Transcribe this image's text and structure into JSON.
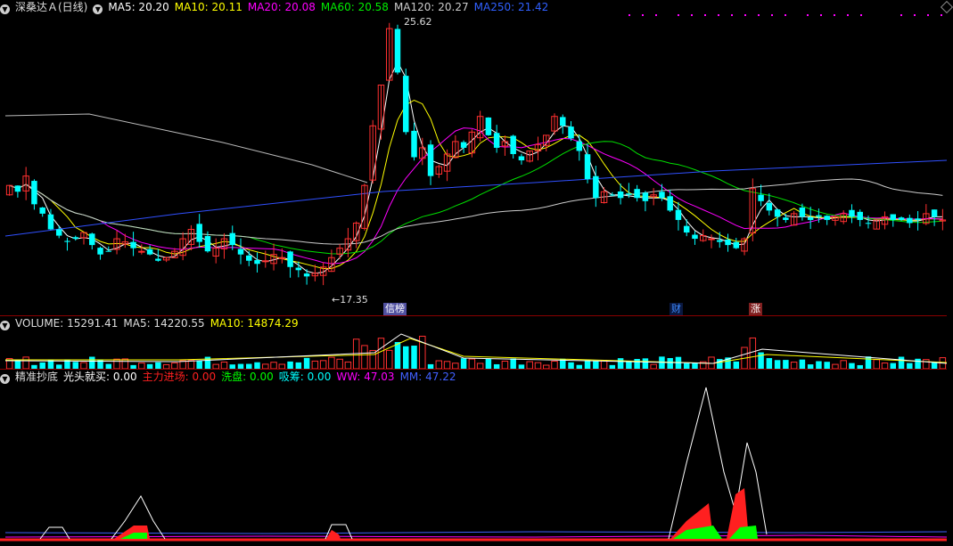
{
  "main_header": {
    "title": "深桑达Ａ(日线)",
    "ma": [
      {
        "label": "MA5: 20.20",
        "color": "#ffffff"
      },
      {
        "label": "MA10: 20.11",
        "color": "#ffff00"
      },
      {
        "label": "MA20: 20.08",
        "color": "#ff00ff"
      },
      {
        "label": "MA60: 20.58",
        "color": "#00e000"
      },
      {
        "label": "MA120: 20.27",
        "color": "#cccccc"
      },
      {
        "label": "MA250: 21.42",
        "color": "#3060ff"
      }
    ]
  },
  "price_labels": {
    "high": "25.62",
    "low": "←17.35"
  },
  "events": [
    {
      "label": "信榜",
      "color": "#ffffff",
      "bg": "#5050a0"
    },
    {
      "label": "财",
      "color": "#3d8bff",
      "bg": "#0a1840"
    },
    {
      "label": "涨",
      "color": "#ffffff",
      "bg": "#802020"
    }
  ],
  "volume_header": {
    "title": "VOLUME: 15291.41",
    "ma5": "MA5: 14220.55",
    "ma10": "MA10: 14874.29"
  },
  "indicator_header": {
    "title": "精准抄底",
    "items": [
      {
        "label": "光头就买: 0.00",
        "color": "#ffffff"
      },
      {
        "label": "主力进场: 0.00",
        "color": "#ff2020"
      },
      {
        "label": "洗盘: 0.00",
        "color": "#00ff00"
      },
      {
        "label": "吸筹: 0.00",
        "color": "#00ffff"
      },
      {
        "label": "WW: 47.03",
        "color": "#ff00ff"
      },
      {
        "label": "MM: 47.22",
        "color": "#4060ff"
      }
    ]
  },
  "colors": {
    "up": "#ff3030",
    "down": "#00ffff",
    "separator": "#8a0000"
  },
  "chart_data": {
    "type": "candlestick",
    "high_mark": 25.62,
    "low_mark": 17.35,
    "closes": [
      20.6,
      20.4,
      20.9,
      20.0,
      19.7,
      19.2,
      19.0,
      18.8,
      18.9,
      19.1,
      18.7,
      18.4,
      18.5,
      18.9,
      18.8,
      18.6,
      18.5,
      18.4,
      18.2,
      18.3,
      18.5,
      18.9,
      19.2,
      18.8,
      18.5,
      18.6,
      18.9,
      18.7,
      18.4,
      18.2,
      18.1,
      18.2,
      18.4,
      18.3,
      18.0,
      17.9,
      17.7,
      17.8,
      18.0,
      18.3,
      18.6,
      18.9,
      19.4,
      20.6,
      22.5,
      23.8,
      25.6,
      24.2,
      22.3,
      21.5,
      21.8,
      20.9,
      21.2,
      21.6,
      22.0,
      21.8,
      22.3,
      22.8,
      22.2,
      21.8,
      22.0,
      21.6,
      21.4,
      21.7,
      21.9,
      22.2,
      22.8,
      22.5,
      22.1,
      21.7,
      20.8,
      20.2,
      20.4,
      20.3,
      20.2,
      20.3,
      20.2,
      20.1,
      20.3,
      20.2,
      19.8,
      19.5,
      19.1,
      18.9,
      19.0,
      18.9,
      18.8,
      18.7,
      18.6,
      18.9,
      20.5,
      20.1,
      19.8,
      19.6,
      19.5,
      19.7,
      19.6,
      19.5,
      19.6,
      19.5,
      19.6,
      19.7,
      19.6,
      19.5,
      19.4,
      19.5,
      19.6,
      19.5,
      19.5,
      19.4,
      19.5,
      19.7,
      19.6,
      19.5
    ]
  }
}
